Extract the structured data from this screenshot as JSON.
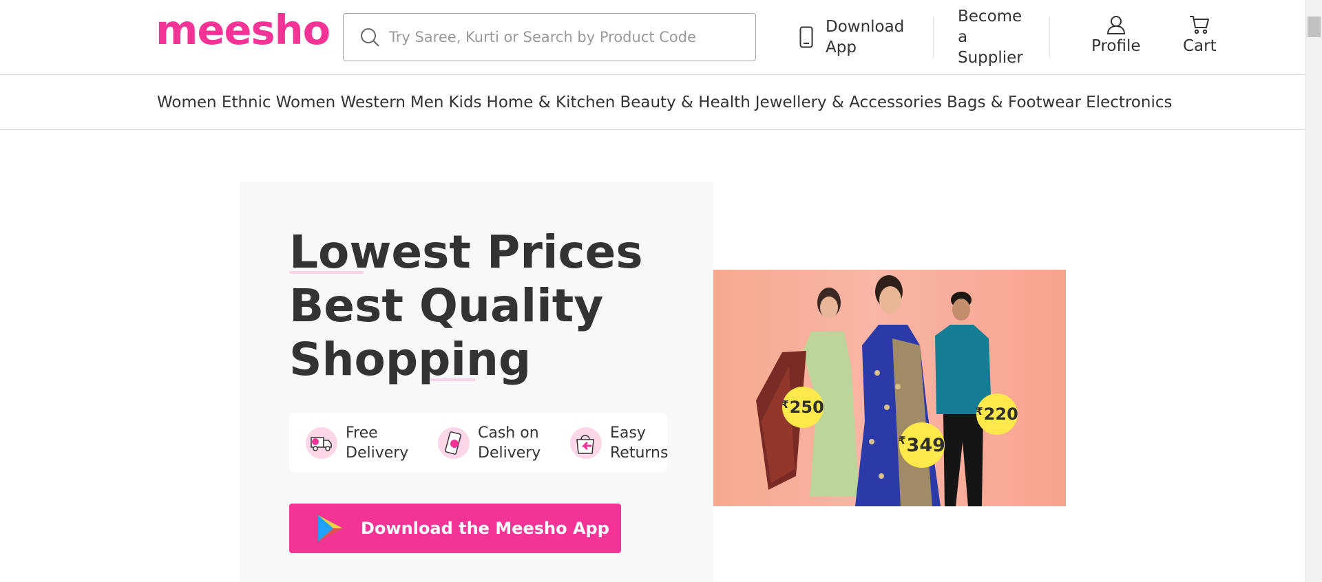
{
  "header": {
    "logo": "meesho",
    "search_placeholder": "Try Saree, Kurti or Search by Product Code",
    "download_app": [
      "Download",
      "App"
    ],
    "become_supplier": [
      "Become",
      "a",
      "Supplier"
    ],
    "profile": "Profile",
    "cart": "Cart"
  },
  "categories": [
    "Women Ethnic",
    "Women Western",
    "Men",
    "Kids",
    "Home & Kitchen",
    "Beauty & Health",
    "Jewellery & Accessories",
    "Bags & Footwear",
    "Electronics"
  ],
  "hero": {
    "headline": [
      "Lowest Prices",
      "Best Quality",
      "Shopping"
    ],
    "features": [
      {
        "icon": "delivery-truck-icon",
        "line1": "Free",
        "line2": "Delivery"
      },
      {
        "icon": "cash-on-delivery-icon",
        "line1": "Cash on",
        "line2": "Delivery"
      },
      {
        "icon": "easy-returns-icon",
        "line1": "Easy",
        "line2": "Returns"
      }
    ],
    "cta": "Download the Meesho App",
    "price_tags": [
      {
        "currency": "₹",
        "amount": "250"
      },
      {
        "currency": "₹",
        "amount": "349"
      },
      {
        "currency": "₹",
        "amount": "220"
      }
    ]
  },
  "colors": {
    "brand": "#f43397",
    "accent_light": "#fdd6e8",
    "price_tag": "#ffe84a"
  }
}
